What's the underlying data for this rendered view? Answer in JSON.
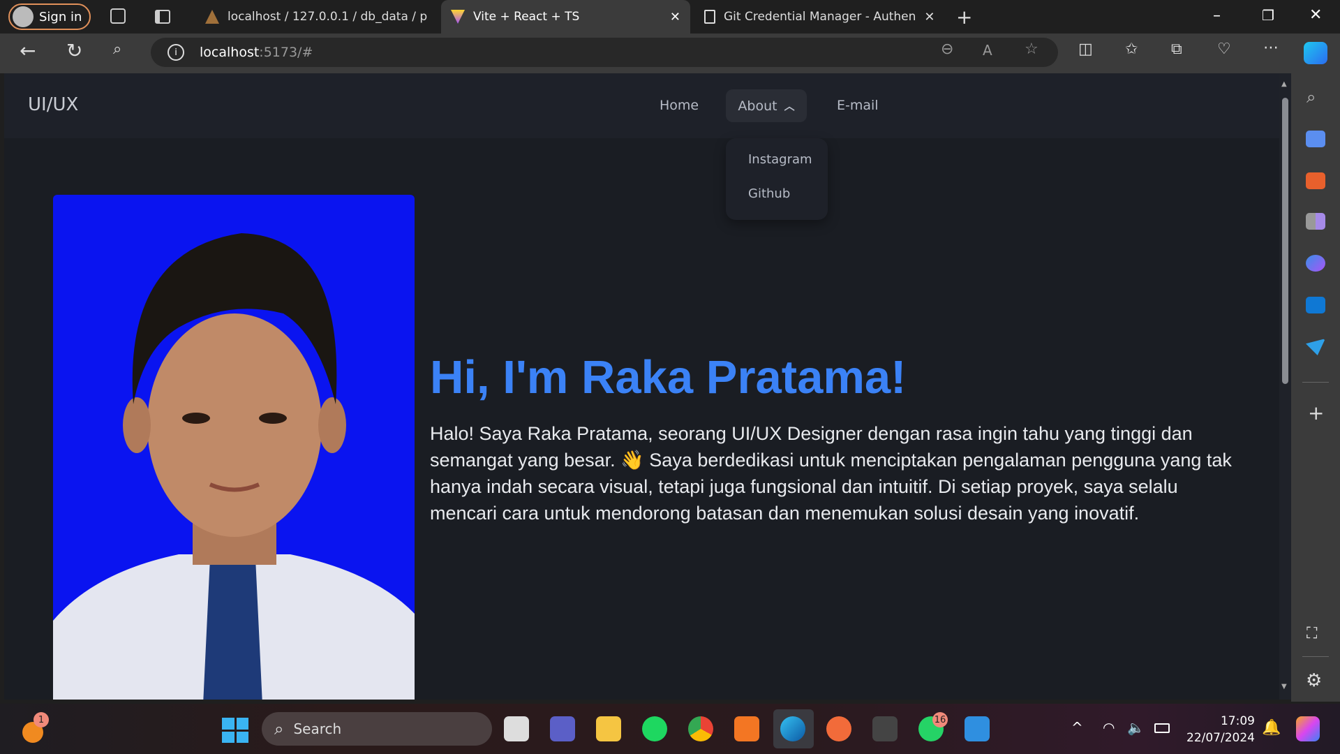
{
  "browser": {
    "sign_in": "Sign in",
    "tabs": [
      {
        "title": "localhost / 127.0.0.1 / db_data / p"
      },
      {
        "title": "Vite + React + TS",
        "active": true
      },
      {
        "title": "Git Credential Manager - Authen"
      }
    ],
    "url_host": "localhost",
    "url_rest": ":5173/#"
  },
  "site": {
    "logo": "UI/UX",
    "nav": {
      "home": "Home",
      "about": "About",
      "email": "E-mail"
    },
    "dropdown": [
      "Instagram",
      "Github"
    ],
    "heading": "Hi, I'm Raka Pratama!",
    "paragraph": "Halo! Saya Raka Pratama, seorang UI/UX Designer dengan rasa ingin tahu yang tinggi dan semangat yang besar. 👋 Saya berdedikasi untuk menciptakan pengalaman pengguna yang tak hanya indah secara visual, tetapi juga fungsional dan intuitif. Di setiap proyek, saya selalu mencari cara untuk mendorong batasan dan menemukan solusi desain yang inovatif.",
    "accent": "#3b82f6"
  },
  "taskbar": {
    "search": "Search",
    "time": "17:09",
    "date": "22/07/2024",
    "notif_badge": "1",
    "whatsapp_badge": "16"
  }
}
